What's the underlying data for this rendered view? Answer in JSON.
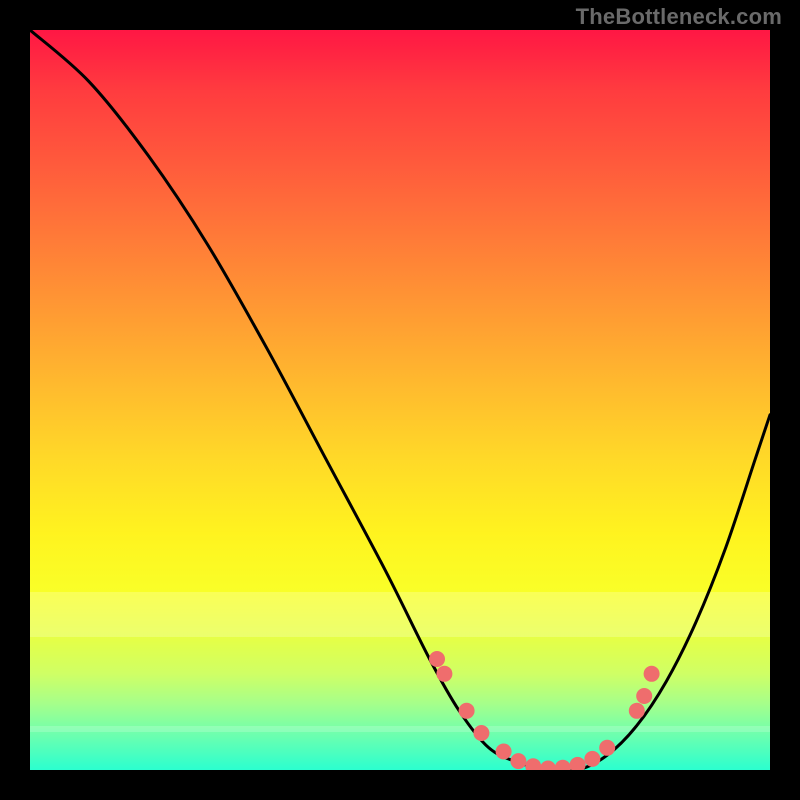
{
  "watermark": "TheBottleneck.com",
  "colors": {
    "curve": "#000000",
    "marker_fill": "#ef6d6d",
    "marker_stroke": "#ef6d6d",
    "frame": "#000000"
  },
  "chart_data": {
    "type": "line",
    "title": "",
    "xlabel": "",
    "ylabel": "",
    "xlim": [
      0,
      100
    ],
    "ylim": [
      0,
      100
    ],
    "grid": false,
    "legend": false,
    "series": [
      {
        "name": "bottleneck-curve",
        "x": [
          0,
          8,
          16,
          24,
          32,
          40,
          48,
          54,
          58,
          62,
          66,
          70,
          74,
          78,
          82,
          86,
          90,
          94,
          98,
          100
        ],
        "y": [
          100,
          93,
          83,
          71,
          57,
          42,
          27,
          15,
          8,
          3,
          1,
          0,
          0,
          2,
          6,
          12,
          20,
          30,
          42,
          48
        ]
      }
    ],
    "markers": {
      "name": "highlight-points",
      "x": [
        55,
        56,
        59,
        61,
        64,
        66,
        68,
        70,
        72,
        74,
        76,
        78,
        82,
        83,
        84
      ],
      "y": [
        15,
        13,
        8,
        5,
        2.5,
        1.2,
        0.5,
        0.2,
        0.3,
        0.7,
        1.5,
        3,
        8,
        10,
        13
      ]
    }
  }
}
